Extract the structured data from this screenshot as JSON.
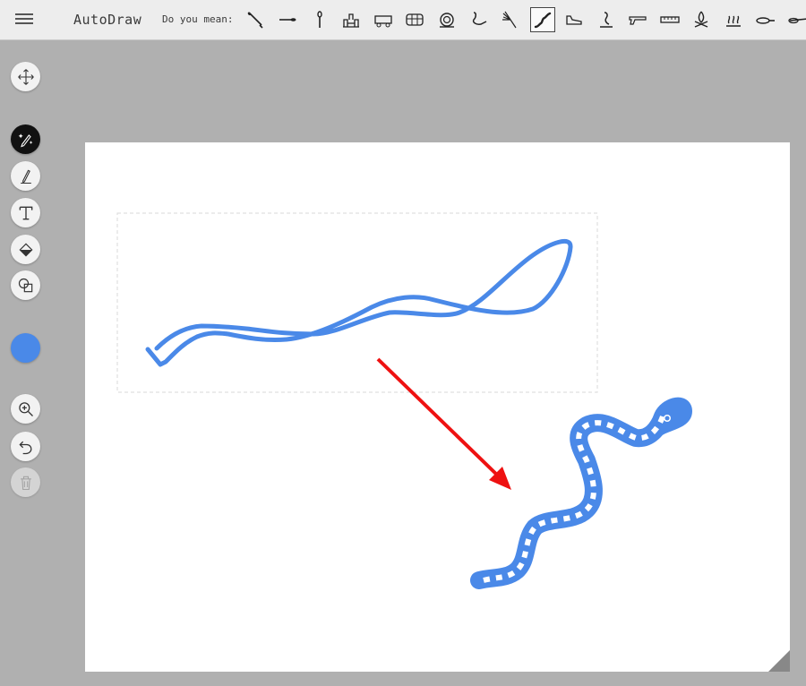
{
  "app": {
    "title": "AutoDraw"
  },
  "suggestions": {
    "label": "Do you mean:",
    "items": [
      {
        "name": "wrench-icon"
      },
      {
        "name": "spoon-icon"
      },
      {
        "name": "spoon-vertical-icon"
      },
      {
        "name": "castle-icon"
      },
      {
        "name": "train-icon"
      },
      {
        "name": "bus-icon"
      },
      {
        "name": "snail-icon"
      },
      {
        "name": "swan-icon"
      },
      {
        "name": "sprinkler-icon"
      },
      {
        "name": "snake-icon",
        "selected": true
      },
      {
        "name": "shoe-icon"
      },
      {
        "name": "cobra-icon"
      },
      {
        "name": "gun-icon"
      },
      {
        "name": "ruler-icon"
      },
      {
        "name": "campfire-icon"
      },
      {
        "name": "steam-icon"
      },
      {
        "name": "frying-pan-icon"
      },
      {
        "name": "pan-icon"
      }
    ]
  },
  "colors": {
    "stroke": "#4a89e8",
    "arrow": "#ee1111",
    "canvas": "#ffffff",
    "background": "#b0b0b0"
  },
  "toolbar": {
    "tools": [
      "move-tool",
      "autodraw-tool",
      "draw-tool",
      "type-tool",
      "fill-tool",
      "shape-tool",
      "color-tool",
      "zoom-tool",
      "undo-tool",
      "delete-tool"
    ]
  }
}
